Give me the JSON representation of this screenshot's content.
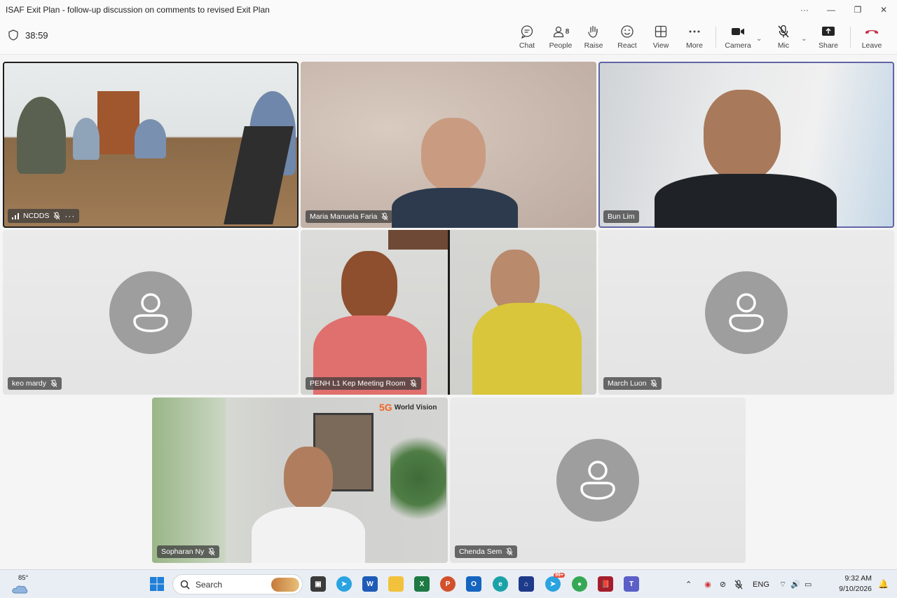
{
  "window": {
    "title": "ISAF Exit Plan - follow-up discussion on comments to revised Exit Plan",
    "controls": {
      "more": "···",
      "minimize": "—",
      "restore": "❐",
      "close": "✕"
    }
  },
  "meeting": {
    "elapsed": "38:59",
    "toolbar": {
      "chat": "Chat",
      "people": "People",
      "people_count": "8",
      "raise": "Raise",
      "react": "React",
      "view": "View",
      "more": "More",
      "camera": "Camera",
      "mic": "Mic",
      "share": "Share",
      "leave": "Leave"
    },
    "accent_color": "#6264a7",
    "leave_color": "#c4314b"
  },
  "participants": [
    {
      "name": "NCDDS",
      "muted": true,
      "video": true
    },
    {
      "name": "Maria Manuela Faria",
      "muted": true,
      "video": true
    },
    {
      "name": "Bun Lim",
      "muted": false,
      "video": true,
      "speaking": true
    },
    {
      "name": "keo mardy",
      "muted": true,
      "video": false
    },
    {
      "name": "PENH L1 Kep Meeting Room",
      "muted": true,
      "video": true
    },
    {
      "name": "March Luon",
      "muted": true,
      "video": false
    },
    {
      "name": "Sopharan Ny",
      "muted": true,
      "video": true
    },
    {
      "name": "Chenda Sem",
      "muted": true,
      "video": false
    }
  ],
  "video_text": {
    "world_vision": "World Vision"
  },
  "taskbar": {
    "weather_temp": "85°",
    "search_placeholder": "Search",
    "telegram_badge": "99+",
    "language": "ENG",
    "time": "9:32 AM",
    "date": "9/10/2026"
  }
}
